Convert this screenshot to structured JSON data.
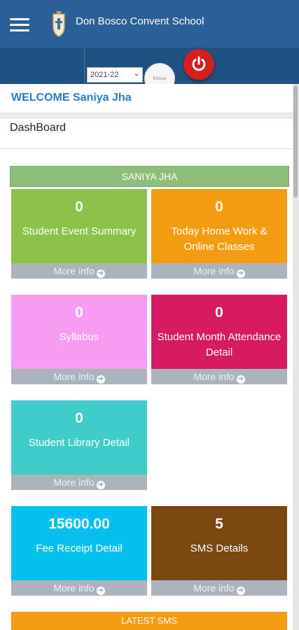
{
  "header": {
    "school_name": "Don Bosco Convent School"
  },
  "subbar": {
    "session_year": "2021-22",
    "avatar_text": "Picture"
  },
  "welcome": {
    "text": "WELCOME Saniya Jha"
  },
  "dashboard": {
    "title": "DashBoard",
    "student_name": "SANIYA JHA",
    "more_info_label": "More info",
    "cards": [
      {
        "count": "0",
        "label": "Student Event Summary",
        "color": "#8bc34a"
      },
      {
        "count": "0",
        "label": "Today Home Work & Online Classes",
        "color": "#f39c12"
      },
      {
        "count": "0",
        "label": "Syllabus",
        "color": "#f79cf2"
      },
      {
        "count": "0",
        "label": "Student Month Attendance Detail",
        "color": "#d81b60"
      },
      {
        "count": "0",
        "label": "Student Library Detail",
        "color": "#40ccc8"
      },
      {
        "count": "15600.00",
        "label": "Fee Receipt Detail",
        "color": "#03c0ef"
      },
      {
        "count": "5",
        "label": "SMS Details",
        "color": "#7b4710"
      }
    ],
    "latest_sms_label": "LATEST SMS"
  },
  "colors": {
    "topbar": "#2a5f97",
    "subbar": "#1f5280",
    "welcome_text": "#2a7cc1",
    "power_button": "#d61e1e"
  }
}
